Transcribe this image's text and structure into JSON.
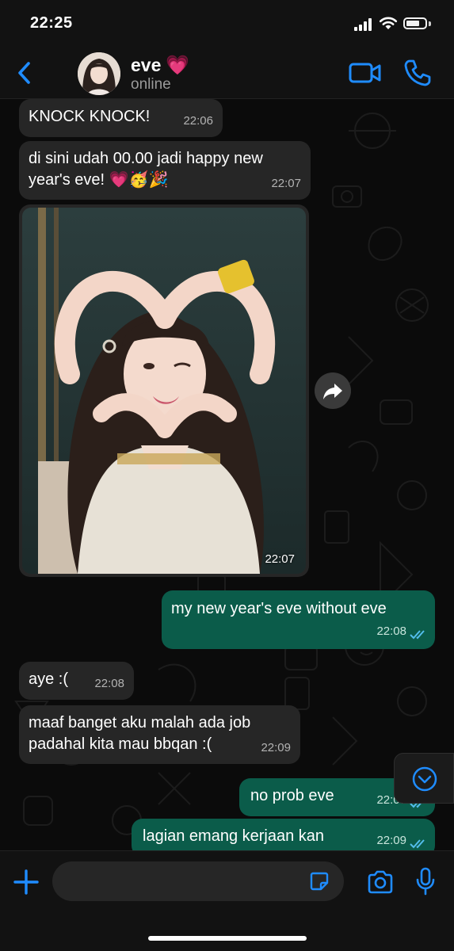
{
  "status_bar": {
    "time": "22:25",
    "icons": [
      "signal-icon",
      "wifi-icon",
      "battery-icon"
    ]
  },
  "header": {
    "contact_name": "eve",
    "name_emoji": "💗",
    "status": "online",
    "icons": [
      "back-chevron-icon",
      "video-call-icon",
      "phone-icon"
    ]
  },
  "messages": [
    {
      "direction": "in",
      "text": "KNOCK KNOCK!",
      "time": "22:06"
    },
    {
      "direction": "in",
      "text": "di sini udah 00.00 jadi happy new year's eve! 💗🥳🎉",
      "line1": "di sini udah 00.00 jadi happy new",
      "line2": "year's eve! 💗🥳🎉",
      "time": "22:07"
    },
    {
      "direction": "in",
      "type": "photo",
      "time": "22:07"
    },
    {
      "direction": "out",
      "text": "my new year's eve without eve",
      "time": "22:08",
      "read": true
    },
    {
      "direction": "in",
      "text": "aye :(",
      "time": "22:08"
    },
    {
      "direction": "in",
      "text": "maaf banget aku malah ada job padahal kita mau bbqan :(",
      "line1": "maaf banget aku malah ada job",
      "line2": "padahal kita mau bbqan :(",
      "time": "22:09"
    },
    {
      "direction": "out",
      "text": "no prob eve",
      "time": "22:09",
      "read": true
    },
    {
      "direction": "out",
      "text": "lagian emang kerjaan kan",
      "time": "22:09",
      "read": true
    }
  ],
  "input": {
    "placeholder": "",
    "value": ""
  },
  "colors": {
    "background": "#0b0b0b",
    "incoming_bubble": "#262626",
    "outgoing_bubble": "#0b5c4a",
    "accent": "#1f8cff",
    "read_ticks": "#53bdeb"
  }
}
